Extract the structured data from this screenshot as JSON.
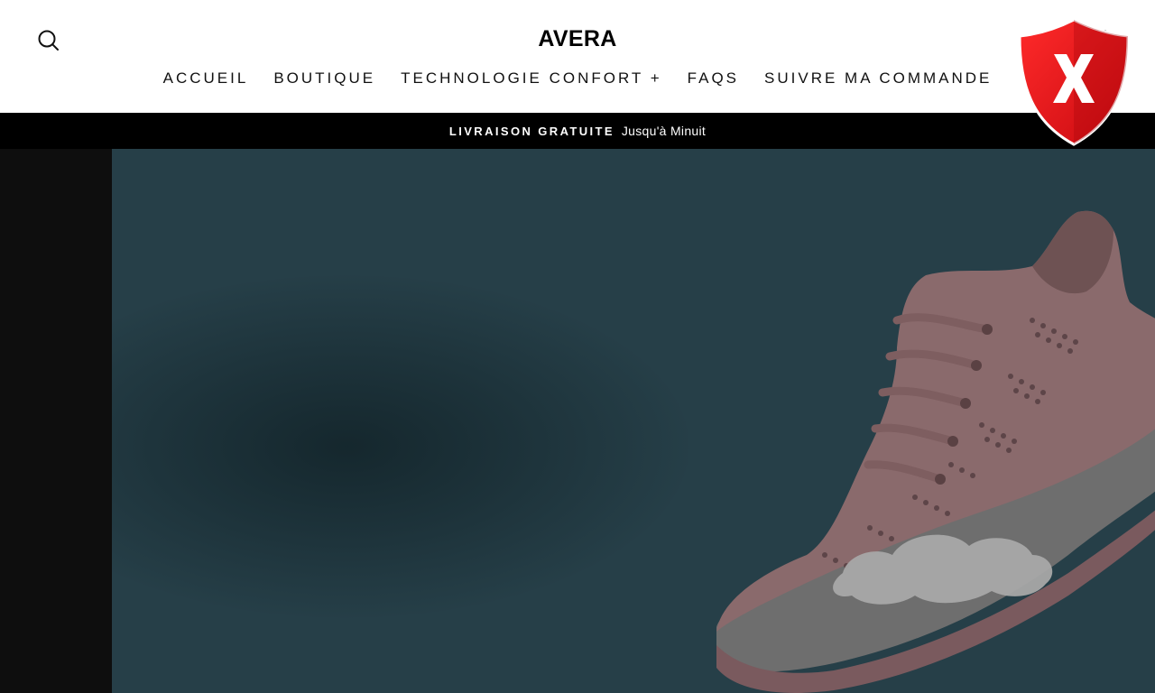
{
  "header": {
    "logo_text": "AVERA",
    "search_icon": "search-icon",
    "cart_icon": "cart-icon",
    "nav": [
      {
        "label": "ACCUEIL"
      },
      {
        "label": "BOUTIQUE"
      },
      {
        "label": "TECHNOLOGIE CONFORT +"
      },
      {
        "label": "FAQS"
      },
      {
        "label": "SUIVRE MA COMMANDE"
      }
    ]
  },
  "overlay": {
    "icon": "shield-x-icon",
    "glyph": "X",
    "color": "#e8141b"
  },
  "announcement": {
    "strong": "LIVRAISON GRATUITE",
    "rest": "Jusqu'à Minuit"
  },
  "hero": {
    "image": "sneaker-image",
    "background_color": "#263f48"
  }
}
